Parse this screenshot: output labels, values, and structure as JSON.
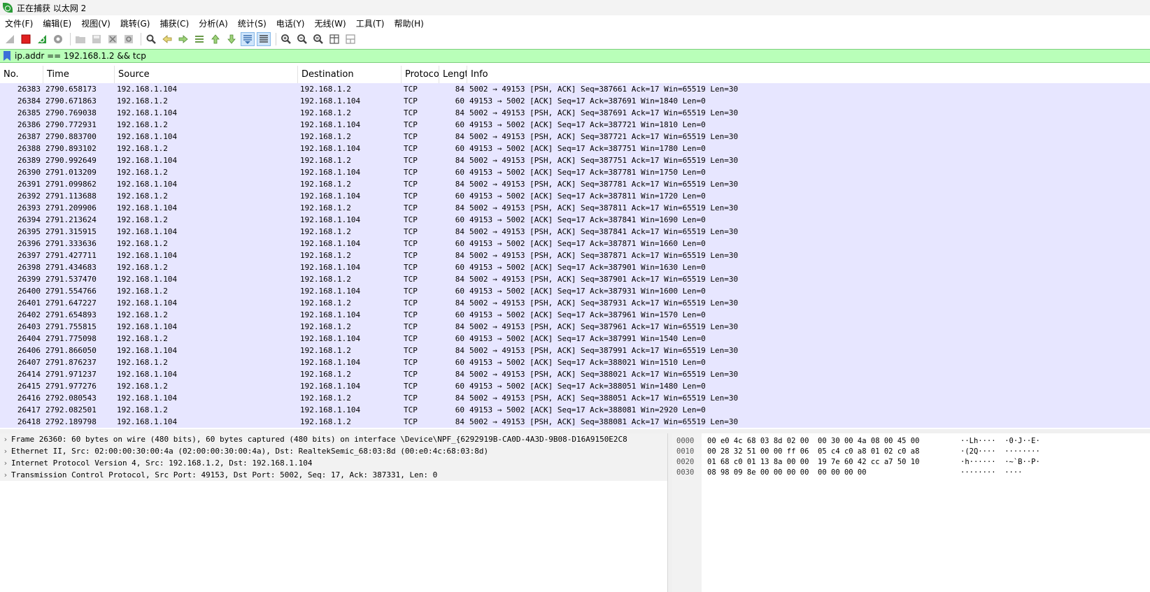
{
  "window": {
    "title": "正在捕获 以太网 2",
    "app_icon": "wireshark-fin-icon"
  },
  "menu": [
    "文件(F)",
    "编辑(E)",
    "视图(V)",
    "跳转(G)",
    "捕获(C)",
    "分析(A)",
    "统计(S)",
    "电话(Y)",
    "无线(W)",
    "工具(T)",
    "帮助(H)"
  ],
  "toolbar": {
    "icons": [
      "shark-fin-icon",
      "stop-capture-icon",
      "restart-capture-icon",
      "capture-options-icon",
      "open-file-icon",
      "save-file-icon",
      "close-file-icon",
      "reload-file-icon",
      "find-packet-icon",
      "go-back-icon",
      "go-forward-icon",
      "go-to-packet-icon",
      "first-packet-icon",
      "last-packet-icon",
      "autoscroll-icon",
      "colorize-icon",
      "zoom-in-icon",
      "zoom-out-icon",
      "normal-size-icon",
      "resize-columns-icon",
      "layout-icon"
    ]
  },
  "filter": {
    "value": "ip.addr == 192.168.1.2 && tcp",
    "bookmark_icon": "bookmark-icon",
    "background": "#b9ffb9"
  },
  "packet_list": {
    "columns": [
      "No.",
      "Time",
      "Source",
      "Destination",
      "Protoco",
      "Lengt",
      "Info"
    ],
    "row_color": "#e7e6ff",
    "rows": [
      {
        "no": "26383",
        "time": "2790.658173",
        "src": "192.168.1.104",
        "dst": "192.168.1.2",
        "proto": "TCP",
        "len": "84",
        "info": "5002 → 49153 [PSH, ACK] Seq=387661 Ack=17 Win=65519 Len=30"
      },
      {
        "no": "26384",
        "time": "2790.671863",
        "src": "192.168.1.2",
        "dst": "192.168.1.104",
        "proto": "TCP",
        "len": "60",
        "info": "49153 → 5002 [ACK] Seq=17 Ack=387691 Win=1840 Len=0"
      },
      {
        "no": "26385",
        "time": "2790.769038",
        "src": "192.168.1.104",
        "dst": "192.168.1.2",
        "proto": "TCP",
        "len": "84",
        "info": "5002 → 49153 [PSH, ACK] Seq=387691 Ack=17 Win=65519 Len=30"
      },
      {
        "no": "26386",
        "time": "2790.772931",
        "src": "192.168.1.2",
        "dst": "192.168.1.104",
        "proto": "TCP",
        "len": "60",
        "info": "49153 → 5002 [ACK] Seq=17 Ack=387721 Win=1810 Len=0"
      },
      {
        "no": "26387",
        "time": "2790.883700",
        "src": "192.168.1.104",
        "dst": "192.168.1.2",
        "proto": "TCP",
        "len": "84",
        "info": "5002 → 49153 [PSH, ACK] Seq=387721 Ack=17 Win=65519 Len=30"
      },
      {
        "no": "26388",
        "time": "2790.893102",
        "src": "192.168.1.2",
        "dst": "192.168.1.104",
        "proto": "TCP",
        "len": "60",
        "info": "49153 → 5002 [ACK] Seq=17 Ack=387751 Win=1780 Len=0"
      },
      {
        "no": "26389",
        "time": "2790.992649",
        "src": "192.168.1.104",
        "dst": "192.168.1.2",
        "proto": "TCP",
        "len": "84",
        "info": "5002 → 49153 [PSH, ACK] Seq=387751 Ack=17 Win=65519 Len=30"
      },
      {
        "no": "26390",
        "time": "2791.013209",
        "src": "192.168.1.2",
        "dst": "192.168.1.104",
        "proto": "TCP",
        "len": "60",
        "info": "49153 → 5002 [ACK] Seq=17 Ack=387781 Win=1750 Len=0"
      },
      {
        "no": "26391",
        "time": "2791.099862",
        "src": "192.168.1.104",
        "dst": "192.168.1.2",
        "proto": "TCP",
        "len": "84",
        "info": "5002 → 49153 [PSH, ACK] Seq=387781 Ack=17 Win=65519 Len=30"
      },
      {
        "no": "26392",
        "time": "2791.113688",
        "src": "192.168.1.2",
        "dst": "192.168.1.104",
        "proto": "TCP",
        "len": "60",
        "info": "49153 → 5002 [ACK] Seq=17 Ack=387811 Win=1720 Len=0"
      },
      {
        "no": "26393",
        "time": "2791.209906",
        "src": "192.168.1.104",
        "dst": "192.168.1.2",
        "proto": "TCP",
        "len": "84",
        "info": "5002 → 49153 [PSH, ACK] Seq=387811 Ack=17 Win=65519 Len=30"
      },
      {
        "no": "26394",
        "time": "2791.213624",
        "src": "192.168.1.2",
        "dst": "192.168.1.104",
        "proto": "TCP",
        "len": "60",
        "info": "49153 → 5002 [ACK] Seq=17 Ack=387841 Win=1690 Len=0"
      },
      {
        "no": "26395",
        "time": "2791.315915",
        "src": "192.168.1.104",
        "dst": "192.168.1.2",
        "proto": "TCP",
        "len": "84",
        "info": "5002 → 49153 [PSH, ACK] Seq=387841 Ack=17 Win=65519 Len=30"
      },
      {
        "no": "26396",
        "time": "2791.333636",
        "src": "192.168.1.2",
        "dst": "192.168.1.104",
        "proto": "TCP",
        "len": "60",
        "info": "49153 → 5002 [ACK] Seq=17 Ack=387871 Win=1660 Len=0"
      },
      {
        "no": "26397",
        "time": "2791.427711",
        "src": "192.168.1.104",
        "dst": "192.168.1.2",
        "proto": "TCP",
        "len": "84",
        "info": "5002 → 49153 [PSH, ACK] Seq=387871 Ack=17 Win=65519 Len=30"
      },
      {
        "no": "26398",
        "time": "2791.434683",
        "src": "192.168.1.2",
        "dst": "192.168.1.104",
        "proto": "TCP",
        "len": "60",
        "info": "49153 → 5002 [ACK] Seq=17 Ack=387901 Win=1630 Len=0"
      },
      {
        "no": "26399",
        "time": "2791.537470",
        "src": "192.168.1.104",
        "dst": "192.168.1.2",
        "proto": "TCP",
        "len": "84",
        "info": "5002 → 49153 [PSH, ACK] Seq=387901 Ack=17 Win=65519 Len=30"
      },
      {
        "no": "26400",
        "time": "2791.554766",
        "src": "192.168.1.2",
        "dst": "192.168.1.104",
        "proto": "TCP",
        "len": "60",
        "info": "49153 → 5002 [ACK] Seq=17 Ack=387931 Win=1600 Len=0"
      },
      {
        "no": "26401",
        "time": "2791.647227",
        "src": "192.168.1.104",
        "dst": "192.168.1.2",
        "proto": "TCP",
        "len": "84",
        "info": "5002 → 49153 [PSH, ACK] Seq=387931 Ack=17 Win=65519 Len=30"
      },
      {
        "no": "26402",
        "time": "2791.654893",
        "src": "192.168.1.2",
        "dst": "192.168.1.104",
        "proto": "TCP",
        "len": "60",
        "info": "49153 → 5002 [ACK] Seq=17 Ack=387961 Win=1570 Len=0"
      },
      {
        "no": "26403",
        "time": "2791.755815",
        "src": "192.168.1.104",
        "dst": "192.168.1.2",
        "proto": "TCP",
        "len": "84",
        "info": "5002 → 49153 [PSH, ACK] Seq=387961 Ack=17 Win=65519 Len=30"
      },
      {
        "no": "26404",
        "time": "2791.775098",
        "src": "192.168.1.2",
        "dst": "192.168.1.104",
        "proto": "TCP",
        "len": "60",
        "info": "49153 → 5002 [ACK] Seq=17 Ack=387991 Win=1540 Len=0"
      },
      {
        "no": "26406",
        "time": "2791.866050",
        "src": "192.168.1.104",
        "dst": "192.168.1.2",
        "proto": "TCP",
        "len": "84",
        "info": "5002 → 49153 [PSH, ACK] Seq=387991 Ack=17 Win=65519 Len=30"
      },
      {
        "no": "26407",
        "time": "2791.876237",
        "src": "192.168.1.2",
        "dst": "192.168.1.104",
        "proto": "TCP",
        "len": "60",
        "info": "49153 → 5002 [ACK] Seq=17 Ack=388021 Win=1510 Len=0"
      },
      {
        "no": "26414",
        "time": "2791.971237",
        "src": "192.168.1.104",
        "dst": "192.168.1.2",
        "proto": "TCP",
        "len": "84",
        "info": "5002 → 49153 [PSH, ACK] Seq=388021 Ack=17 Win=65519 Len=30"
      },
      {
        "no": "26415",
        "time": "2791.977276",
        "src": "192.168.1.2",
        "dst": "192.168.1.104",
        "proto": "TCP",
        "len": "60",
        "info": "49153 → 5002 [ACK] Seq=17 Ack=388051 Win=1480 Len=0"
      },
      {
        "no": "26416",
        "time": "2792.080543",
        "src": "192.168.1.104",
        "dst": "192.168.1.2",
        "proto": "TCP",
        "len": "84",
        "info": "5002 → 49153 [PSH, ACK] Seq=388051 Ack=17 Win=65519 Len=30"
      },
      {
        "no": "26417",
        "time": "2792.082501",
        "src": "192.168.1.2",
        "dst": "192.168.1.104",
        "proto": "TCP",
        "len": "60",
        "info": "49153 → 5002 [ACK] Seq=17 Ack=388081 Win=2920 Len=0"
      },
      {
        "no": "26418",
        "time": "2792.189798",
        "src": "192.168.1.104",
        "dst": "192.168.1.2",
        "proto": "TCP",
        "len": "84",
        "info": "5002 → 49153 [PSH, ACK] Seq=388081 Ack=17 Win=65519 Len=30"
      }
    ]
  },
  "details": [
    "Frame 26360: 60 bytes on wire (480 bits), 60 bytes captured (480 bits) on interface \\Device\\NPF_{6292919B-CA0D-4A3D-9B08-D16A9150E2C8",
    "Ethernet II, Src: 02:00:00:30:00:4a (02:00:00:30:00:4a), Dst: RealtekSemic_68:03:8d (00:e0:4c:68:03:8d)",
    "Internet Protocol Version 4, Src: 192.168.1.2, Dst: 192.168.1.104",
    "Transmission Control Protocol, Src Port: 49153, Dst Port: 5002, Seq: 17, Ack: 387331, Len: 0"
  ],
  "bytes": [
    {
      "offset": "0000",
      "hex": "00 e0 4c 68 03 8d 02 00  00 30 00 4a 08 00 45 00",
      "ascii": "··Lh····  ·0·J··E·"
    },
    {
      "offset": "0010",
      "hex": "00 28 32 51 00 00 ff 06  05 c4 c0 a8 01 02 c0 a8",
      "ascii": "·(2Q····  ········"
    },
    {
      "offset": "0020",
      "hex": "01 68 c0 01 13 8a 00 00  19 7e 60 42 cc a7 50 10",
      "ascii": "·h······  ·~`B··P·"
    },
    {
      "offset": "0030",
      "hex": "08 98 09 8e 00 00 00 00  00 00 00 00",
      "ascii": "········  ····"
    }
  ]
}
